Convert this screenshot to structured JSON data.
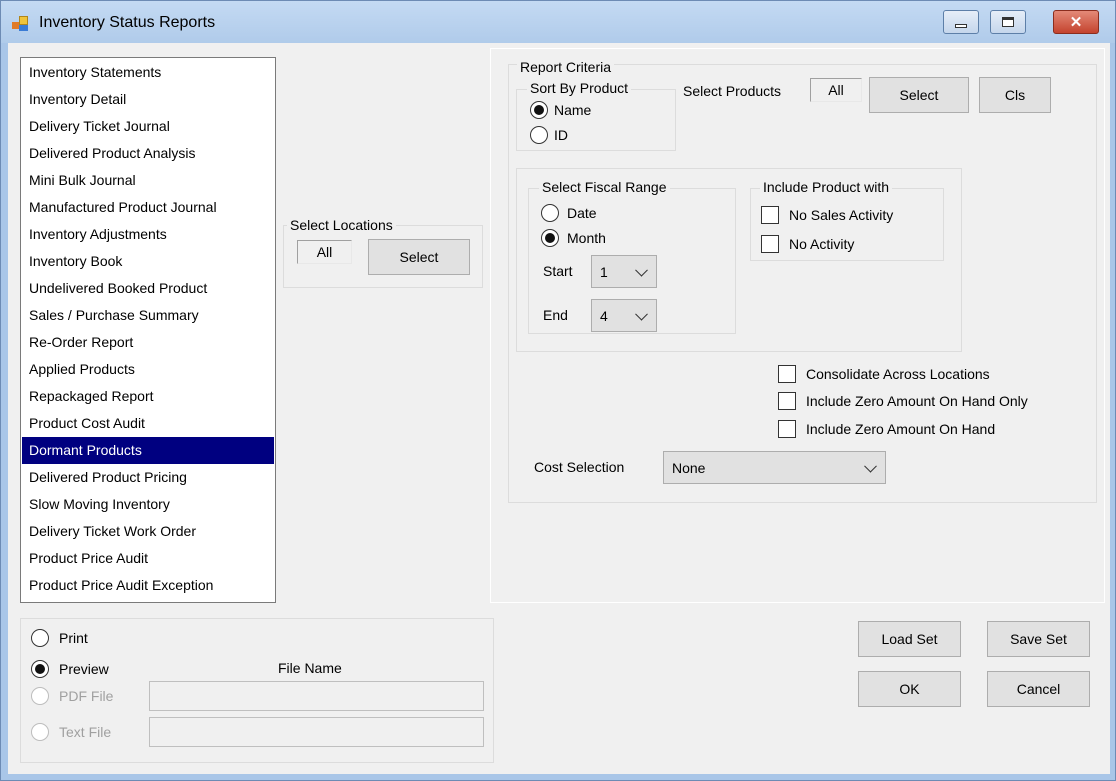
{
  "window": {
    "title": "Inventory Status Reports",
    "close_glyph": "✕"
  },
  "reports": {
    "items": [
      "Inventory Statements",
      "Inventory Detail",
      "Delivery Ticket Journal",
      "Delivered Product Analysis",
      "Mini Bulk Journal",
      "Manufactured Product Journal",
      "Inventory Adjustments",
      "Inventory Book",
      "Undelivered Booked Product",
      "Sales / Purchase Summary",
      "Re-Order Report",
      "Applied Products",
      "Repackaged Report",
      "Product Cost Audit",
      "Dormant Products",
      "Delivered Product Pricing",
      "Slow Moving Inventory",
      "Delivery Ticket Work Order",
      "Product Price Audit",
      "Product Price Audit Exception"
    ],
    "selected": "Dormant Products"
  },
  "locations": {
    "label": "Select Locations",
    "value": "All",
    "select_label": "Select"
  },
  "criteria": {
    "label": "Report Criteria",
    "sort": {
      "label": "Sort By Product",
      "options": [
        "Name",
        "ID"
      ],
      "selected": "Name"
    },
    "products": {
      "label": "Select Products",
      "value": "All",
      "select_label": "Select",
      "clear_label": "Cls"
    },
    "fiscal": {
      "label": "Select Fiscal Range",
      "options": [
        "Date",
        "Month"
      ],
      "selected": "Month",
      "start_label": "Start",
      "start_value": "1",
      "end_label": "End",
      "end_value": "4"
    },
    "include": {
      "label": "Include Product with",
      "options": [
        "No Sales Activity",
        "No Activity"
      ]
    },
    "checks": [
      "Consolidate Across Locations",
      "Include Zero Amount On Hand Only",
      "Include Zero Amount On Hand"
    ],
    "cost": {
      "label": "Cost Selection",
      "value": "None"
    }
  },
  "output": {
    "options": [
      "Print",
      "Preview",
      "PDF File",
      "Text File"
    ],
    "selected": "Preview",
    "file_name_label": "File Name"
  },
  "buttons": {
    "load_set": "Load Set",
    "save_set": "Save Set",
    "ok": "OK",
    "cancel": "Cancel"
  }
}
